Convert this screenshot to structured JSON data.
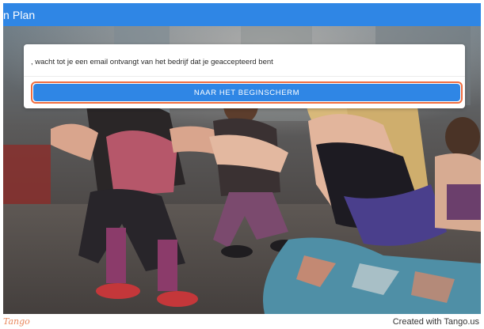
{
  "header": {
    "title": "n Plan",
    "color": "#2f86e5"
  },
  "dialog": {
    "message": ", wacht tot je een email ontvangt van het bedrijf dat je geaccepteerd bent",
    "button_label": "NAAR HET BEGINSCHERM",
    "button_color": "#2f86e5",
    "highlight_color": "#f06d3f"
  },
  "background": {
    "icon": "fitness-class-photo"
  },
  "footer": {
    "logo_text": "Tango",
    "credit": "Created with Tango.us"
  }
}
